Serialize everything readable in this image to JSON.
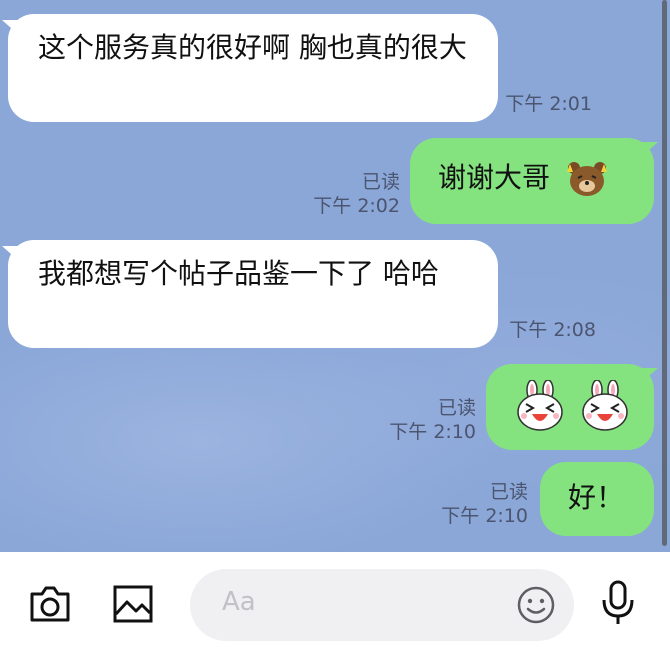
{
  "messages": [
    {
      "text": "这个服务真的很好啊 胸也真的很大",
      "time": "下午 2:01"
    },
    {
      "text": "谢谢大哥",
      "emoji": "bear-emoji",
      "read": "已读",
      "time": "下午 2:02"
    },
    {
      "text": "我都想写个帖子品鉴一下了 哈哈",
      "time": "下午 2:08"
    },
    {
      "stickers": [
        "bunny-sticker",
        "bunny-sticker"
      ],
      "read": "已读",
      "time": "下午 2:10"
    },
    {
      "text": "好！",
      "read": "已读",
      "time": "下午 2:10"
    }
  ],
  "toolbar": {
    "camera": "camera-icon",
    "gallery": "image-icon",
    "placeholder": "Aa",
    "emoji": "smiley-icon",
    "mic": "microphone-icon"
  },
  "colors": {
    "background": "#8aa7d8",
    "outgoing": "#84e37f",
    "incoming": "#ffffff"
  }
}
